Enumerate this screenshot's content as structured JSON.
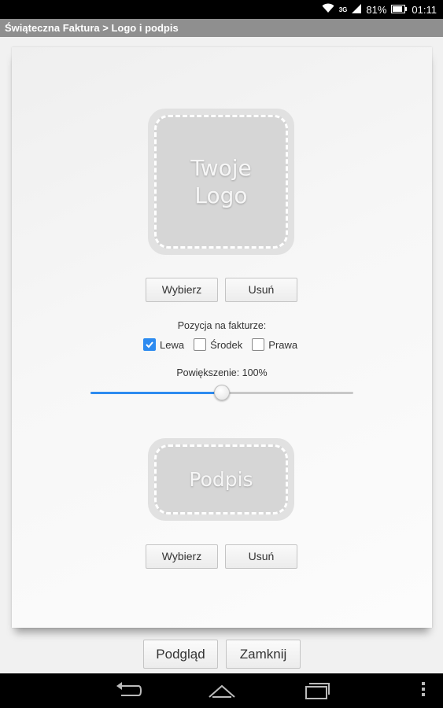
{
  "status_bar": {
    "battery_percent": "81%",
    "time": "01:11",
    "network": "3G"
  },
  "title_bar": {
    "breadcrumb": "Świąteczna Faktura > Logo i podpis"
  },
  "logo_section": {
    "placeholder_line1": "Twoje",
    "placeholder_line2": "Logo",
    "choose_label": "Wybierz",
    "remove_label": "Usuń",
    "position_label": "Pozycja na fakturze:",
    "position_options": [
      {
        "label": "Lewa",
        "checked": true
      },
      {
        "label": "Środek",
        "checked": false
      },
      {
        "label": "Prawa",
        "checked": false
      }
    ],
    "zoom_label": "Powiększenie: 100%",
    "zoom_slider_fraction": 0.5
  },
  "signature_section": {
    "placeholder": "Podpis",
    "choose_label": "Wybierz",
    "remove_label": "Usuń"
  },
  "footer": {
    "preview_label": "Podgląd",
    "close_label": "Zamknij"
  },
  "colors": {
    "accent": "#2d8bf0",
    "title_bar": "#8f8f8f"
  }
}
